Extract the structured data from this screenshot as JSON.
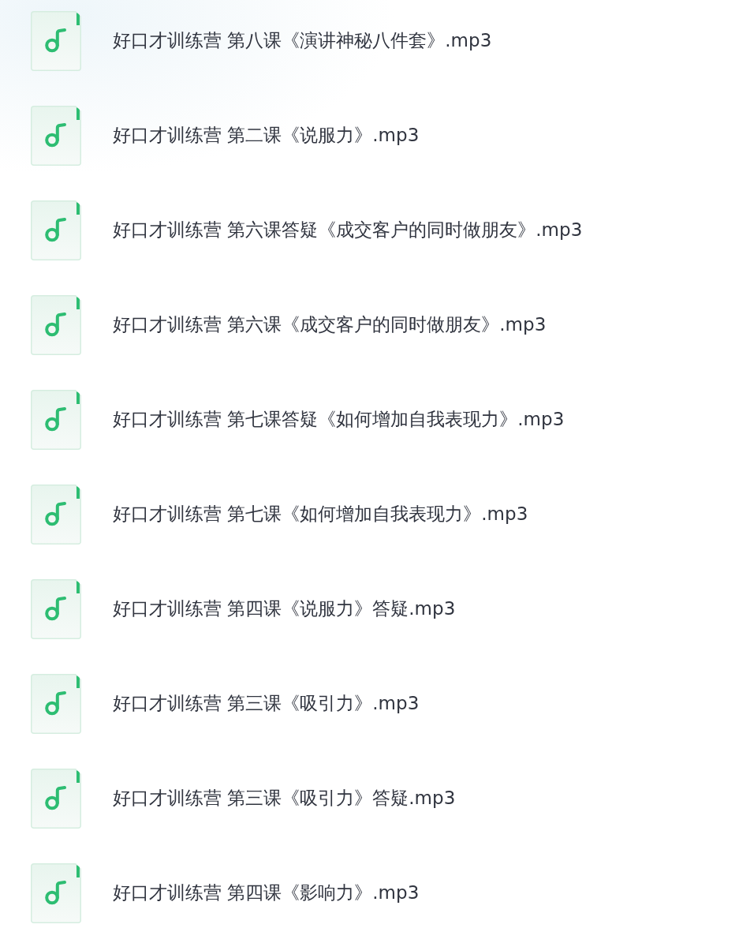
{
  "files": [
    {
      "name": "好口才训练营 第八课《演讲神秘八件套》.mp3"
    },
    {
      "name": "好口才训练营 第二课《说服力》.mp3"
    },
    {
      "name": "好口才训练营 第六课答疑《成交客户的同时做朋友》.mp3"
    },
    {
      "name": "好口才训练营 第六课《成交客户的同时做朋友》.mp3"
    },
    {
      "name": "好口才训练营 第七课答疑《如何增加自我表现力》.mp3"
    },
    {
      "name": "好口才训练营 第七课《如何增加自我表现力》.mp3"
    },
    {
      "name": "好口才训练营 第四课《说服力》答疑.mp3"
    },
    {
      "name": "好口才训练营 第三课《吸引力》.mp3"
    },
    {
      "name": "好口才训练营 第三课《吸引力》答疑.mp3"
    },
    {
      "name": "好口才训练营 第四课《影响力》.mp3"
    }
  ]
}
